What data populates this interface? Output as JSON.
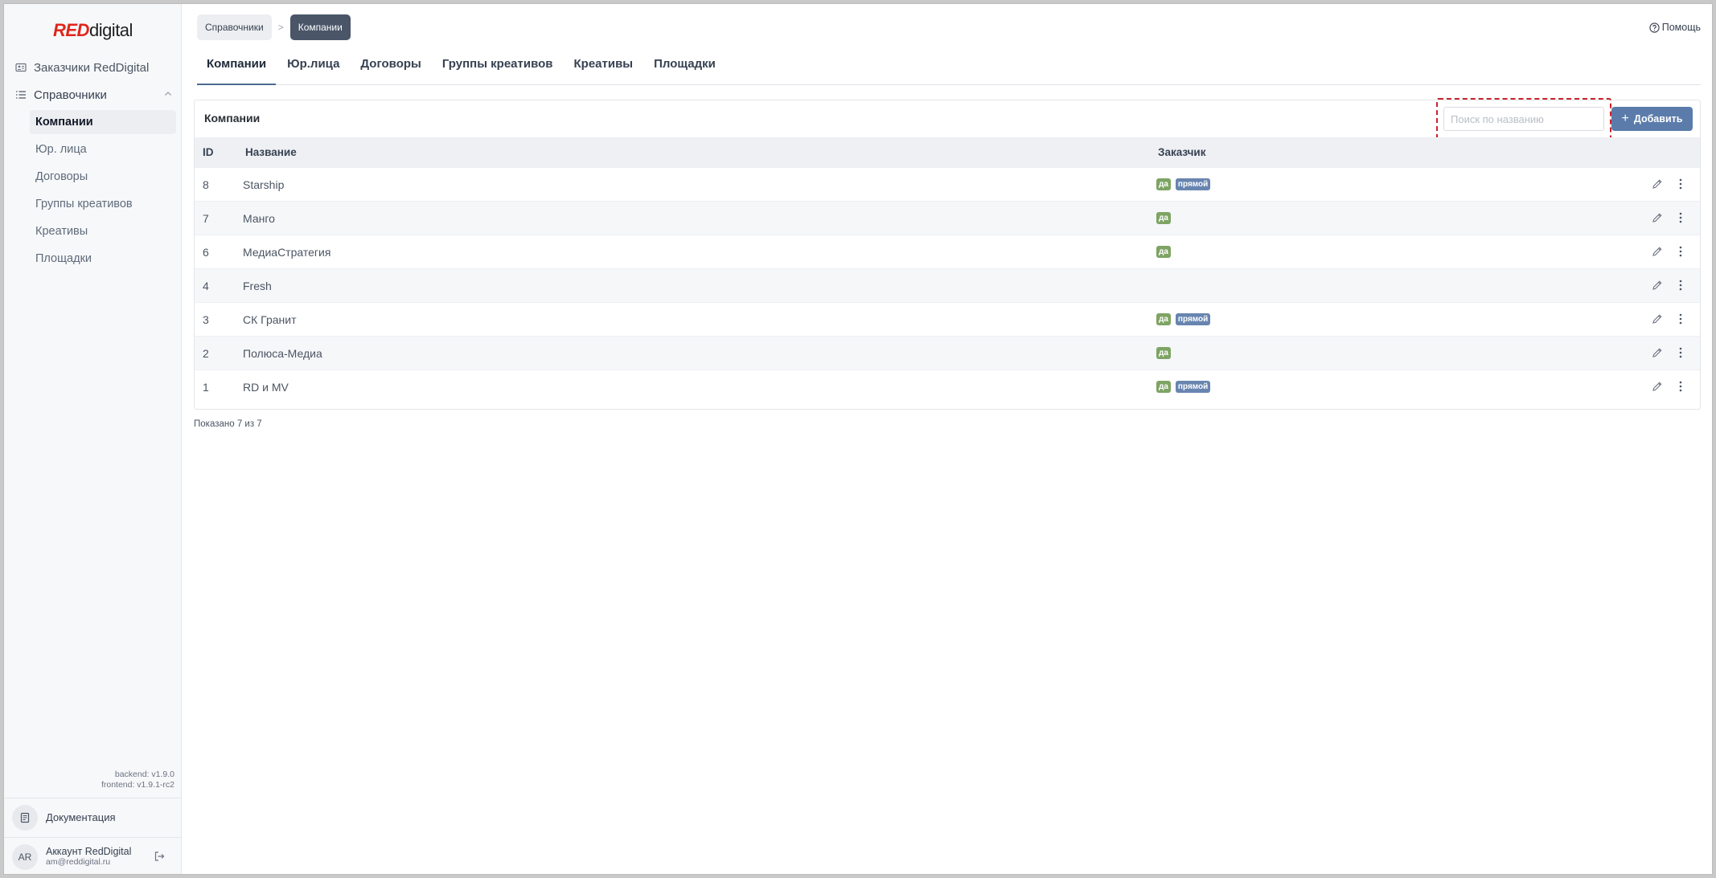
{
  "logo": {
    "red": "RED",
    "digital": "digital"
  },
  "sidebar": {
    "top_item": {
      "label": "Заказчики RedDigital",
      "icon": "customers-icon"
    },
    "group": {
      "label": "Справочники",
      "icon": "list-icon"
    },
    "items": [
      {
        "label": "Компании",
        "active": true
      },
      {
        "label": "Юр. лица",
        "active": false
      },
      {
        "label": "Договоры",
        "active": false
      },
      {
        "label": "Группы креативов",
        "active": false
      },
      {
        "label": "Креативы",
        "active": false
      },
      {
        "label": "Площадки",
        "active": false
      }
    ],
    "versions": {
      "backend": "backend: v1.9.0",
      "frontend": "frontend: v1.9.1-rc2"
    },
    "docs_label": "Документация",
    "account": {
      "initials": "AR",
      "name": "Аккаунт RedDigital",
      "email": "am@reddigital.ru"
    }
  },
  "breadcrumb": {
    "first": "Справочники",
    "separator": ">",
    "current": "Компании"
  },
  "help_label": "Помощь",
  "tabs": [
    {
      "label": "Компании",
      "active": true
    },
    {
      "label": "Юр.лица",
      "active": false
    },
    {
      "label": "Договоры",
      "active": false
    },
    {
      "label": "Группы креативов",
      "active": false
    },
    {
      "label": "Креативы",
      "active": false
    },
    {
      "label": "Площадки",
      "active": false
    }
  ],
  "card": {
    "title": "Компании",
    "search_placeholder": "Поиск по названию",
    "add_label": "Добавить",
    "columns": {
      "id": "ID",
      "name": "Название",
      "customer": "Заказчик"
    },
    "rows": [
      {
        "id": "8",
        "name": "Starship",
        "badges": [
          "да",
          "прямой"
        ]
      },
      {
        "id": "7",
        "name": "Манго",
        "badges": [
          "да"
        ]
      },
      {
        "id": "6",
        "name": "МедиаСтратегия",
        "badges": [
          "да"
        ]
      },
      {
        "id": "4",
        "name": "Fresh",
        "badges": []
      },
      {
        "id": "3",
        "name": "СК Гранит",
        "badges": [
          "да",
          "прямой"
        ]
      },
      {
        "id": "2",
        "name": "Полюса-Медиа",
        "badges": [
          "да"
        ]
      },
      {
        "id": "1",
        "name": "RD и MV",
        "badges": [
          "да",
          "прямой"
        ]
      }
    ]
  },
  "footer": {
    "shown": "Показано 7 из 7"
  },
  "colors": {
    "accent": "#5b7cab",
    "brand_red": "#e1251b",
    "badge_yes": "#7ea464",
    "badge_direct": "#6885b0",
    "highlight": "#c8232c"
  }
}
